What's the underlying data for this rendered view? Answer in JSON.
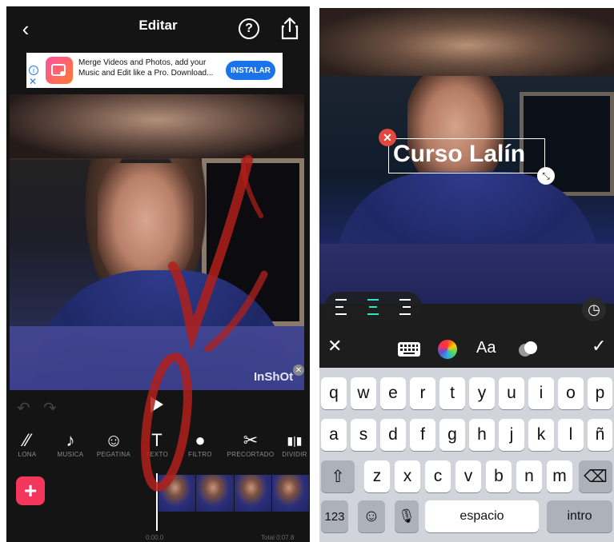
{
  "left": {
    "header": {
      "back_glyph": "‹",
      "title": "Editar",
      "help_glyph": "?"
    },
    "ad": {
      "text": "Merge Videos and Photos, add your Music and Edit like a Pro. Download...",
      "button": "INSTALAR",
      "info_glyph": "i",
      "close_glyph": "✕"
    },
    "watermark": "InShOt",
    "watermark_close": "✕",
    "controls": {
      "undo_glyph": "↶",
      "redo_glyph": "↷"
    },
    "tools": [
      {
        "icon": "lona-icon",
        "glyph": "⁄⁄",
        "label": "LONA"
      },
      {
        "icon": "music-icon",
        "glyph": "♪",
        "label": "MUSICA"
      },
      {
        "icon": "sticker-icon",
        "glyph": "☺",
        "label": "PEGATINA"
      },
      {
        "icon": "text-icon",
        "glyph": "T",
        "label": "TEXTO"
      },
      {
        "icon": "filter-icon",
        "glyph": "●",
        "label": "FILTRO"
      },
      {
        "icon": "scissors-icon",
        "glyph": "✂",
        "label": "PRECORTADO"
      },
      {
        "icon": "split-icon",
        "glyph": "▮|▮",
        "label": "DIVIDIR"
      }
    ],
    "add_glyph": "+",
    "timeline": {
      "current": "0:00.0",
      "total": "Total 0:07.8"
    }
  },
  "right": {
    "overlay_text": "Curso Lalín",
    "delete_glyph": "✕",
    "resize_glyph": "⤡",
    "clock_glyph": "◷",
    "toolbar": {
      "close_glyph": "✕",
      "font_label": "Aa",
      "confirm_glyph": "✓"
    },
    "keyboard": {
      "row1": [
        "q",
        "w",
        "e",
        "r",
        "t",
        "y",
        "u",
        "i",
        "o",
        "p"
      ],
      "row2": [
        "a",
        "s",
        "d",
        "f",
        "g",
        "h",
        "j",
        "k",
        "l",
        "ñ"
      ],
      "row3": [
        "z",
        "x",
        "c",
        "v",
        "b",
        "n",
        "m"
      ],
      "shift_glyph": "⇧",
      "backspace_glyph": "⌫",
      "numbers": "123",
      "emoji_glyph": "☺",
      "mic_glyph": "🎙",
      "space": "espacio",
      "return": "intro"
    }
  },
  "colors": {
    "accent_add": "#f5365c",
    "align_active": "#2ee6c8",
    "ad_button": "#1a73e8",
    "delete_red": "#e2483d"
  }
}
